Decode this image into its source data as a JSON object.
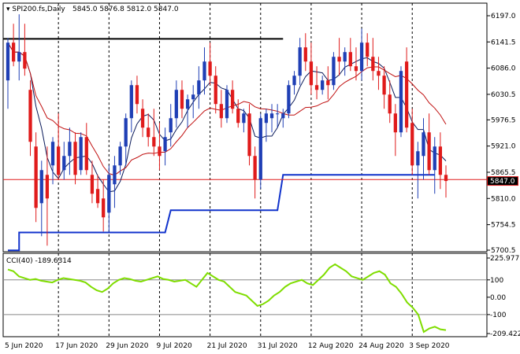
{
  "header": {
    "symbol": "SPI200.fs,Daily",
    "ohlc": "5845.0 5876.8 5812.0 5847.0"
  },
  "colors": {
    "bull": "#1f3fb5",
    "bear": "#e01b1b",
    "ma_fast": "#0a1a5a",
    "ma_slow": "#c01010",
    "support_line": "#1133cc",
    "resistance_line": "#000000",
    "cci_line": "#7fdd00",
    "price_tag_bg": "#e02020"
  },
  "chart_data": [
    {
      "type": "candlestick",
      "title": "",
      "x_labels": [
        "5 Jun 2020",
        "17 Jun 2020",
        "29 Jun 2020",
        "9 Jul 2020",
        "21 Jul 2020",
        "31 Jul 2020",
        "12 Aug 2020",
        "24 Aug 2020",
        "3 Sep 2020"
      ],
      "x_label_index": [
        0,
        9,
        18,
        27,
        36,
        45,
        54,
        63,
        72
      ],
      "y_ticks": [
        "6197.0",
        "6141.5",
        "6086.0",
        "6030.5",
        "5976.5",
        "5921.0",
        "5865.5",
        "5810.0",
        "5754.5",
        "5700.5"
      ],
      "ylim": [
        5700.5,
        6197.0
      ],
      "current_price": "5847.0",
      "resistance_level": 6148,
      "horizontal_marker": 5850,
      "candles": [
        {
          "o": 6060,
          "h": 6150,
          "l": 6000,
          "c": 6140
        },
        {
          "o": 6140,
          "h": 6180,
          "l": 6090,
          "c": 6100
        },
        {
          "o": 6100,
          "h": 6200,
          "l": 6060,
          "c": 6120
        },
        {
          "o": 6120,
          "h": 6180,
          "l": 6070,
          "c": 6085
        },
        {
          "o": 6040,
          "h": 6060,
          "l": 5900,
          "c": 5930
        },
        {
          "o": 5920,
          "h": 5950,
          "l": 5760,
          "c": 5790
        },
        {
          "o": 5800,
          "h": 5890,
          "l": 5730,
          "c": 5870
        },
        {
          "o": 5860,
          "h": 5920,
          "l": 5710,
          "c": 5810
        },
        {
          "o": 5880,
          "h": 5940,
          "l": 5840,
          "c": 5930
        },
        {
          "o": 5920,
          "h": 5990,
          "l": 5850,
          "c": 5860
        },
        {
          "o": 5870,
          "h": 5930,
          "l": 5850,
          "c": 5900
        },
        {
          "o": 5900,
          "h": 5960,
          "l": 5860,
          "c": 5930
        },
        {
          "o": 5930,
          "h": 5950,
          "l": 5840,
          "c": 5860
        },
        {
          "o": 5870,
          "h": 5950,
          "l": 5860,
          "c": 5940
        },
        {
          "o": 5940,
          "h": 5970,
          "l": 5860,
          "c": 5870
        },
        {
          "o": 5860,
          "h": 5890,
          "l": 5800,
          "c": 5820
        },
        {
          "o": 5830,
          "h": 5860,
          "l": 5790,
          "c": 5800
        },
        {
          "o": 5810,
          "h": 5850,
          "l": 5740,
          "c": 5770
        },
        {
          "o": 5780,
          "h": 5880,
          "l": 5740,
          "c": 5860
        },
        {
          "o": 5840,
          "h": 5900,
          "l": 5790,
          "c": 5880
        },
        {
          "o": 5880,
          "h": 5930,
          "l": 5860,
          "c": 5920
        },
        {
          "o": 5920,
          "h": 5990,
          "l": 5880,
          "c": 5980
        },
        {
          "o": 5980,
          "h": 6060,
          "l": 5950,
          "c": 6050
        },
        {
          "o": 6050,
          "h": 6070,
          "l": 5990,
          "c": 6010
        },
        {
          "o": 6000,
          "h": 6020,
          "l": 5940,
          "c": 5960
        },
        {
          "o": 5960,
          "h": 5990,
          "l": 5920,
          "c": 5940
        },
        {
          "o": 5940,
          "h": 6000,
          "l": 5900,
          "c": 5920
        },
        {
          "o": 5920,
          "h": 5970,
          "l": 5870,
          "c": 5900
        },
        {
          "o": 5910,
          "h": 5960,
          "l": 5880,
          "c": 5940
        },
        {
          "o": 5950,
          "h": 6010,
          "l": 5920,
          "c": 5980
        },
        {
          "o": 5980,
          "h": 6060,
          "l": 5960,
          "c": 6040
        },
        {
          "o": 6040,
          "h": 6060,
          "l": 5980,
          "c": 6000
        },
        {
          "o": 6000,
          "h": 6030,
          "l": 5960,
          "c": 6020
        },
        {
          "o": 6020,
          "h": 6050,
          "l": 5980,
          "c": 6030
        },
        {
          "o": 6030,
          "h": 6090,
          "l": 6000,
          "c": 6060
        },
        {
          "o": 6060,
          "h": 6130,
          "l": 6030,
          "c": 6100
        },
        {
          "o": 6100,
          "h": 6140,
          "l": 6050,
          "c": 6070
        },
        {
          "o": 6070,
          "h": 6090,
          "l": 5990,
          "c": 6010
        },
        {
          "o": 6010,
          "h": 6040,
          "l": 5960,
          "c": 5980
        },
        {
          "o": 5980,
          "h": 6050,
          "l": 5970,
          "c": 6040
        },
        {
          "o": 6040,
          "h": 6060,
          "l": 5990,
          "c": 6000
        },
        {
          "o": 6000,
          "h": 6020,
          "l": 5960,
          "c": 5970
        },
        {
          "o": 5970,
          "h": 6000,
          "l": 5950,
          "c": 5990
        },
        {
          "o": 5990,
          "h": 6010,
          "l": 5880,
          "c": 5900
        },
        {
          "o": 5900,
          "h": 5920,
          "l": 5810,
          "c": 5850
        },
        {
          "o": 5850,
          "h": 5990,
          "l": 5830,
          "c": 5980
        },
        {
          "o": 5970,
          "h": 6000,
          "l": 5930,
          "c": 5990
        },
        {
          "o": 5980,
          "h": 6010,
          "l": 5950,
          "c": 5990
        },
        {
          "o": 5990,
          "h": 6010,
          "l": 5960,
          "c": 5990
        },
        {
          "o": 5980,
          "h": 6000,
          "l": 5960,
          "c": 5990
        },
        {
          "o": 5990,
          "h": 6060,
          "l": 5980,
          "c": 6050
        },
        {
          "o": 6050,
          "h": 6080,
          "l": 6030,
          "c": 6070
        },
        {
          "o": 6070,
          "h": 6150,
          "l": 6050,
          "c": 6130
        },
        {
          "o": 6130,
          "h": 6160,
          "l": 6080,
          "c": 6100
        },
        {
          "o": 6100,
          "h": 6140,
          "l": 6030,
          "c": 6050
        },
        {
          "o": 6050,
          "h": 6090,
          "l": 6020,
          "c": 6040
        },
        {
          "o": 6040,
          "h": 6070,
          "l": 6030,
          "c": 6060
        },
        {
          "o": 6060,
          "h": 6090,
          "l": 6020,
          "c": 6050
        },
        {
          "o": 6050,
          "h": 6120,
          "l": 6040,
          "c": 6110
        },
        {
          "o": 6110,
          "h": 6150,
          "l": 6070,
          "c": 6100
        },
        {
          "o": 6100,
          "h": 6130,
          "l": 6070,
          "c": 6120
        },
        {
          "o": 6120,
          "h": 6150,
          "l": 6080,
          "c": 6090
        },
        {
          "o": 6090,
          "h": 6130,
          "l": 6060,
          "c": 6080
        },
        {
          "o": 6080,
          "h": 6170,
          "l": 6060,
          "c": 6140
        },
        {
          "o": 6140,
          "h": 6160,
          "l": 6090,
          "c": 6110
        },
        {
          "o": 6110,
          "h": 6150,
          "l": 6060,
          "c": 6080
        },
        {
          "o": 6080,
          "h": 6110,
          "l": 6040,
          "c": 6070
        },
        {
          "o": 6070,
          "h": 6090,
          "l": 6000,
          "c": 6030
        },
        {
          "o": 6030,
          "h": 6060,
          "l": 5970,
          "c": 5990
        },
        {
          "o": 5990,
          "h": 6010,
          "l": 5900,
          "c": 5950
        },
        {
          "o": 5950,
          "h": 6090,
          "l": 5940,
          "c": 6080
        },
        {
          "o": 6100,
          "h": 6130,
          "l": 5950,
          "c": 5960
        },
        {
          "o": 5970,
          "h": 6000,
          "l": 5860,
          "c": 5880
        },
        {
          "o": 5880,
          "h": 5930,
          "l": 5810,
          "c": 5910
        },
        {
          "o": 5900,
          "h": 5980,
          "l": 5850,
          "c": 5950
        },
        {
          "o": 5950,
          "h": 5990,
          "l": 5860,
          "c": 5870
        },
        {
          "o": 5870,
          "h": 5940,
          "l": 5820,
          "c": 5920
        },
        {
          "o": 5920,
          "h": 5950,
          "l": 5830,
          "c": 5860
        },
        {
          "o": 5860,
          "h": 5880,
          "l": 5812,
          "c": 5847
        }
      ]
    },
    {
      "type": "line",
      "title": "CCI(40) -189.6314",
      "y_ticks": [
        "225.9777",
        "100",
        "0.00",
        "-100",
        "-209.422"
      ],
      "ylim": [
        -209.422,
        225.9777
      ],
      "values": [
        160,
        150,
        120,
        110,
        100,
        105,
        95,
        90,
        85,
        100,
        110,
        105,
        100,
        95,
        85,
        60,
        40,
        30,
        50,
        80,
        100,
        110,
        105,
        95,
        90,
        100,
        110,
        120,
        105,
        100,
        90,
        95,
        100,
        80,
        60,
        100,
        140,
        120,
        100,
        90,
        60,
        30,
        20,
        10,
        -20,
        -50,
        -40,
        -20,
        10,
        30,
        60,
        80,
        90,
        100,
        80,
        70,
        100,
        130,
        170,
        190,
        170,
        150,
        120,
        110,
        100,
        120,
        140,
        150,
        130,
        80,
        60,
        20,
        -30,
        -60,
        -100,
        -200,
        -180,
        -170,
        -185,
        -189.6
      ]
    }
  ]
}
